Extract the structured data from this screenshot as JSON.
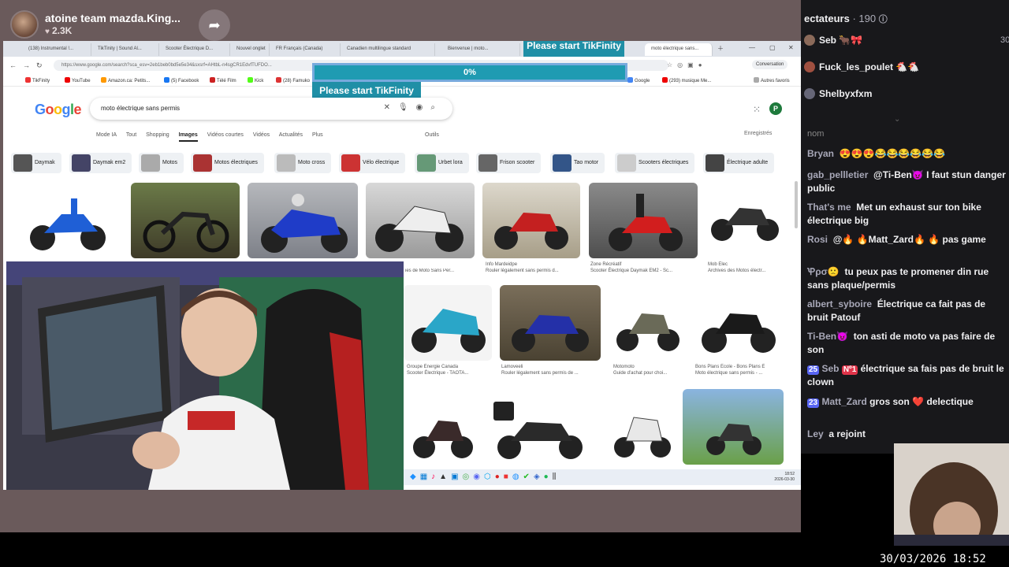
{
  "stream": {
    "title": "atoine team mazda.King...",
    "likes": "2.3K"
  },
  "browser": {
    "tabs": [
      "(138) Instrumental !...",
      "TikTinity | Sound Al...",
      "Scooter Électrique D...",
      "Nouvel onglet",
      "FR Français (Canada)",
      "Canadien multilingue standard",
      "Bienvenue | moto...",
      "moto électrique sans..."
    ],
    "tikfinity_top": "Please start TikFinity",
    "tikfinity_progress": "0%",
    "tikfinity_label": "Please start TikFinity",
    "url": "https://www.google.com/search?sca_esv=2eb1beb0bd5e5e34&sxsrf=AHtbL-n4sgCR1EdvfTUFDO...",
    "conversation": "Conversation",
    "bookmarks": [
      "TikFinity",
      "YouTube",
      "Amazon.ca: Petits...",
      "(5) Facebook",
      "Télé Film",
      "Kick",
      "(28) Famuko",
      "Google",
      "(293) musique Me..."
    ],
    "all_bookmarks": "Autres favoris"
  },
  "google": {
    "logo": "Google",
    "query": "moto électrique sans permis",
    "tabs": [
      "Mode IA",
      "Tout",
      "Shopping",
      "Images",
      "Vidéos courtes",
      "Vidéos",
      "Actualités",
      "Plus"
    ],
    "tools": "Outils",
    "saved": "Enregistrés",
    "profile_letter": "P",
    "chips": [
      "Daymak",
      "Daymak em2",
      "Motos",
      "Motos électriques",
      "Moto cross",
      "Vélo électrique",
      "Urbet lora",
      "Frison scooter",
      "Tao motor",
      "Scooters électriques",
      "Électrique adulte"
    ],
    "row1_captions": [
      {
        "source": "Info Mardeidpe",
        "title": "Rouler légalement sans permis d..."
      },
      {
        "source": "Zone Récréatif",
        "title": "Scooter Électrique Daymak EM2 - Sc..."
      },
      {
        "source": "Mob Elec",
        "title": "Archives des Motos électr..."
      }
    ],
    "row1_left_caption": "ies de Moto Sans Per...",
    "row2_captions": [
      {
        "source": "Groupe Énergie Canada",
        "title": "Scooter Électrique - TAOTA..."
      },
      {
        "source": "Lamoveeli",
        "title": "Rouler légalement sans permis de ..."
      },
      {
        "source": "Motomoto",
        "title": "Guide d'achat pour choi..."
      },
      {
        "source": "Bons Plans École - Bons Plans É",
        "title": "Moto électrique sans permis - ..."
      }
    ]
  },
  "taskbar": {
    "time": "18:52",
    "date": "2026-03-30"
  },
  "chat": {
    "viewers_label": "ectateurs",
    "viewers_count": "· 190",
    "top_count": "30",
    "top_viewers": [
      "Seb",
      "Fuck_les_poulet",
      "Shelbyxfxm"
    ],
    "column_label": "nom",
    "messages": [
      {
        "user": "Bryan",
        "text": "😍😍😍😂😂😂😂😂😂"
      },
      {
        "user": "gab_pellletier",
        "text": "@Ti-Ben😈 I faut stun danger public"
      },
      {
        "user": "That's me",
        "text": "Met un exhaust sur ton bike électrique big"
      },
      {
        "user": "Rosi",
        "text": "@🔥 🔥Matt_Zard🔥 🔥 pas game"
      },
      {
        "user": "Ꝕρσ🙁",
        "text": "tu peux pas te promener din rue sans plaque/permis"
      },
      {
        "user": "albert_syboire",
        "text": "Électrique ca fait pas de bruit Patouf"
      },
      {
        "user": "Ti-Ben😈",
        "text": "ton asti de moto va pas faire de son"
      },
      {
        "user": "Seb",
        "badge": "25",
        "badge2": "Nº1",
        "text": "électrique sa fais pas de bruit le clown"
      },
      {
        "user": "Matt_Zard",
        "badge": "23",
        "text": "gros son ❤️ delectique"
      },
      {
        "user": "Ley",
        "text": "a rejoint"
      }
    ]
  },
  "overlay": {
    "datetime": "30/03/2026 18:52"
  }
}
